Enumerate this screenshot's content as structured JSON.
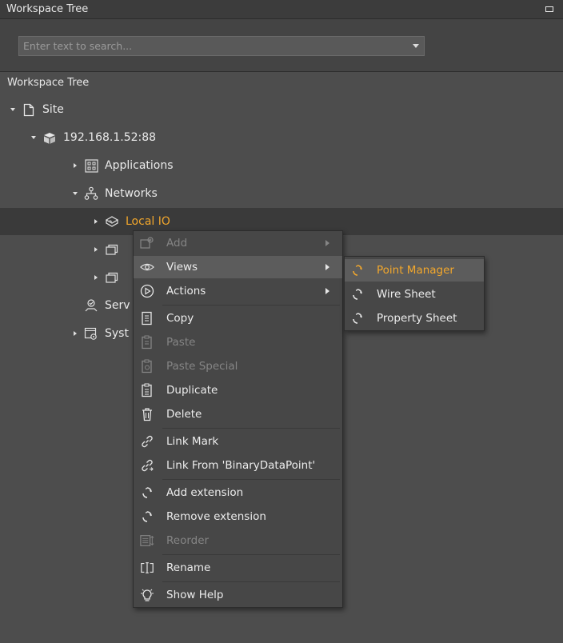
{
  "panel": {
    "title": "Workspace Tree"
  },
  "search": {
    "placeholder": "Enter text to search..."
  },
  "tree": {
    "header": "Workspace Tree",
    "nodes": {
      "site": "Site",
      "host": "192.168.1.52:88",
      "applications": "Applications",
      "networks": "Networks",
      "local_io": "Local IO",
      "services": "Serv",
      "system": "Syst"
    }
  },
  "context_menu": {
    "items": [
      {
        "label": "Add",
        "enabled": false,
        "submenu": true
      },
      {
        "label": "Views",
        "enabled": true,
        "submenu": true,
        "highlighted": true
      },
      {
        "label": "Actions",
        "enabled": true,
        "submenu": true
      },
      {
        "label": "Copy",
        "enabled": true
      },
      {
        "label": "Paste",
        "enabled": false
      },
      {
        "label": "Paste Special",
        "enabled": false
      },
      {
        "label": "Duplicate",
        "enabled": true
      },
      {
        "label": "Delete",
        "enabled": true
      },
      {
        "label": "Link Mark",
        "enabled": true
      },
      {
        "label": "Link From 'BinaryDataPoint'",
        "enabled": true
      },
      {
        "label": "Add extension",
        "enabled": true
      },
      {
        "label": "Remove extension",
        "enabled": true
      },
      {
        "label": "Reorder",
        "enabled": false
      },
      {
        "label": "Rename",
        "enabled": true
      },
      {
        "label": "Show Help",
        "enabled": true
      }
    ]
  },
  "views_submenu": {
    "items": [
      {
        "label": "Point Manager",
        "highlighted": true
      },
      {
        "label": "Wire Sheet"
      },
      {
        "label": "Property Sheet"
      }
    ]
  },
  "colors": {
    "accent": "#f2a72c",
    "background": "#4d4d4d",
    "menu_background": "#474747",
    "highlight": "#5c5c5c",
    "disabled_text": "#858585"
  }
}
